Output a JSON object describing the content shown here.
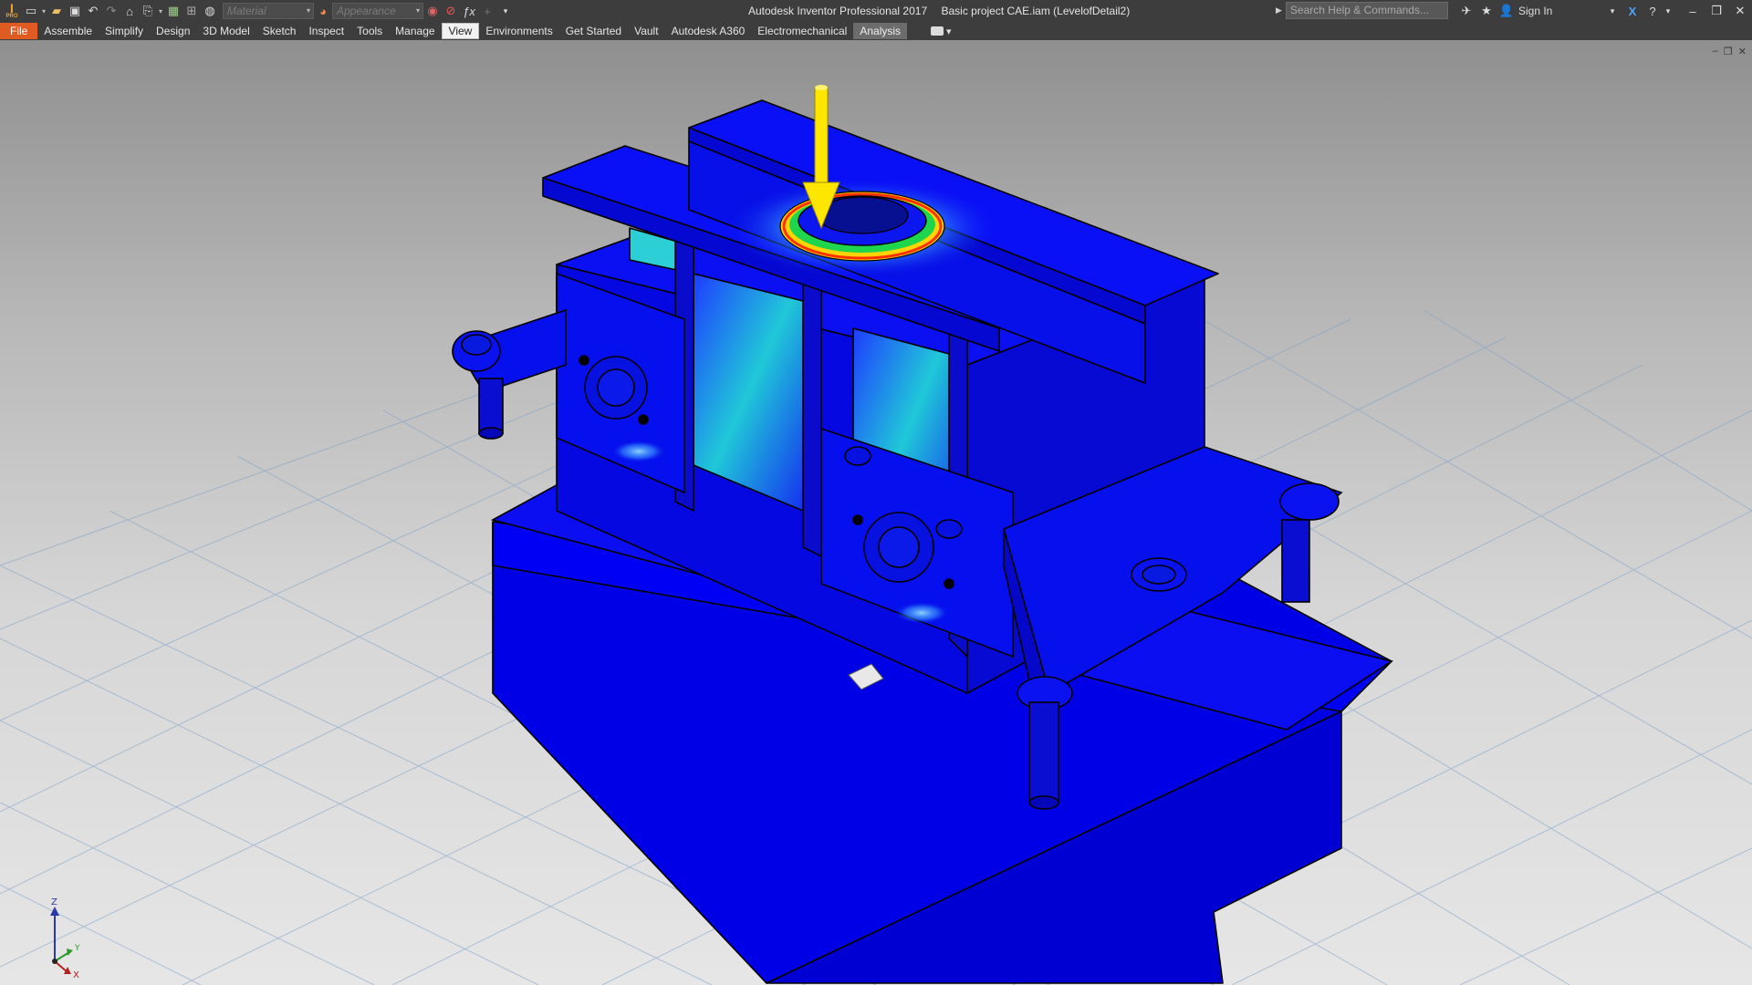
{
  "titlebar": {
    "app_name": "Autodesk Inventor Professional 2017",
    "document_name": "Basic project CAE.iam (LevelofDetail2)",
    "material_placeholder": "Material",
    "appearance_placeholder": "Appearance",
    "search_placeholder": "Search Help & Commands...",
    "sign_in": "Sign In"
  },
  "tabs": [
    {
      "label": "File",
      "kind": "file"
    },
    {
      "label": "Assemble",
      "kind": "normal"
    },
    {
      "label": "Simplify",
      "kind": "normal"
    },
    {
      "label": "Design",
      "kind": "normal"
    },
    {
      "label": "3D Model",
      "kind": "normal"
    },
    {
      "label": "Sketch",
      "kind": "normal"
    },
    {
      "label": "Inspect",
      "kind": "normal"
    },
    {
      "label": "Tools",
      "kind": "normal"
    },
    {
      "label": "Manage",
      "kind": "normal"
    },
    {
      "label": "View",
      "kind": "active"
    },
    {
      "label": "Environments",
      "kind": "normal"
    },
    {
      "label": "Get Started",
      "kind": "normal"
    },
    {
      "label": "Vault",
      "kind": "normal"
    },
    {
      "label": "Autodesk A360",
      "kind": "normal"
    },
    {
      "label": "Electromechanical",
      "kind": "normal"
    },
    {
      "label": "Analysis",
      "kind": "env"
    }
  ],
  "viewcube_axes": {
    "z": "Z",
    "y": "Y",
    "x": "X"
  },
  "colors": {
    "chrome": "#3d3d3d",
    "file_tab": "#e05b21",
    "stress_low": "#0a12e8",
    "stress_mid": "#22d3c8",
    "stress_high": "#ff2a00",
    "load_arrow": "#ffe600"
  },
  "icons": [
    "app-logo-icon",
    "new-icon",
    "open-icon",
    "save-icon",
    "undo-icon",
    "redo-icon",
    "home-icon",
    "return-icon",
    "update-icon",
    "measure-icon",
    "appearance-icon",
    "clear-override-icon",
    "function-icon",
    "search-icon",
    "communication-icon",
    "favorites-icon",
    "user-icon",
    "exchange-icon",
    "help-icon",
    "minimize-icon",
    "restore-icon",
    "close-icon"
  ]
}
